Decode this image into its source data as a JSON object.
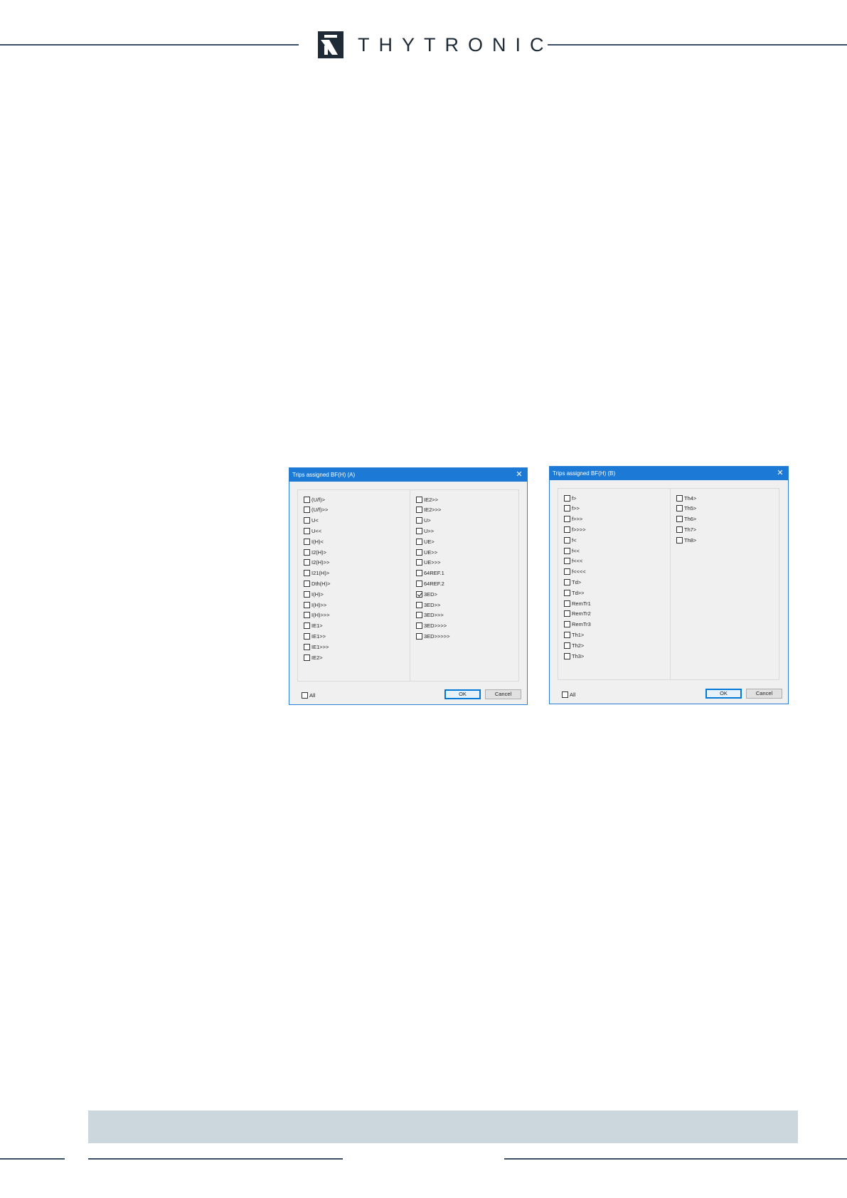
{
  "brand": {
    "name": "THYTRONIC",
    "color": "#1e2a35",
    "logo_icon": "thytronic-logo-icon"
  },
  "dialog_a": {
    "title": "Trips assigned BF(H) (A)",
    "col1": [
      {
        "label": "(U/f)>",
        "checked": false
      },
      {
        "label": "(U/f)>>",
        "checked": false
      },
      {
        "label": "U<",
        "checked": false
      },
      {
        "label": "U<<",
        "checked": false
      },
      {
        "label": "I(H)<",
        "checked": false
      },
      {
        "label": "I2(H)>",
        "checked": false
      },
      {
        "label": "I2(H)>>",
        "checked": false
      },
      {
        "label": "I21(H)>",
        "checked": false
      },
      {
        "label": "Dth(H)>",
        "checked": false
      },
      {
        "label": "I(H)>",
        "checked": false
      },
      {
        "label": "I(H)>>",
        "checked": false
      },
      {
        "label": "I(H)>>>",
        "checked": false
      },
      {
        "label": "IE1>",
        "checked": false
      },
      {
        "label": "IE1>>",
        "checked": false
      },
      {
        "label": "IE1>>>",
        "checked": false
      },
      {
        "label": "IE2>",
        "checked": false
      }
    ],
    "col2": [
      {
        "label": "IE2>>",
        "checked": false
      },
      {
        "label": "IE2>>>",
        "checked": false
      },
      {
        "label": "U>",
        "checked": false
      },
      {
        "label": "U>>",
        "checked": false
      },
      {
        "label": "UE>",
        "checked": false
      },
      {
        "label": "UE>>",
        "checked": false
      },
      {
        "label": "UE>>>",
        "checked": false
      },
      {
        "label": "64REF.1",
        "checked": false
      },
      {
        "label": "64REF.2",
        "checked": false
      },
      {
        "label": "3ED>",
        "checked": true
      },
      {
        "label": "3ED>>",
        "checked": false
      },
      {
        "label": "3ED>>>",
        "checked": false
      },
      {
        "label": "3ED>>>>",
        "checked": false
      },
      {
        "label": "3ED>>>>>",
        "checked": false
      }
    ],
    "all_label": "All",
    "ok_label": "OK",
    "cancel_label": "Cancel"
  },
  "dialog_b": {
    "title": "Trips assigned BF(H) (B)",
    "col1": [
      {
        "label": "f>",
        "checked": false
      },
      {
        "label": "f>>",
        "checked": false
      },
      {
        "label": "f>>>",
        "checked": false
      },
      {
        "label": "f>>>>",
        "checked": false
      },
      {
        "label": "f<",
        "checked": false
      },
      {
        "label": "f<<",
        "checked": false
      },
      {
        "label": "f<<<",
        "checked": false
      },
      {
        "label": "f<<<<",
        "checked": false
      },
      {
        "label": "Td>",
        "checked": false
      },
      {
        "label": "Td>>",
        "checked": false
      },
      {
        "label": "RemTr1",
        "checked": false
      },
      {
        "label": "RemTr2",
        "checked": false
      },
      {
        "label": "RemTr3",
        "checked": false
      },
      {
        "label": "Th1>",
        "checked": false
      },
      {
        "label": "Th2>",
        "checked": false
      },
      {
        "label": "Th3>",
        "checked": false
      }
    ],
    "col2": [
      {
        "label": "Th4>",
        "checked": false
      },
      {
        "label": "Th5>",
        "checked": false
      },
      {
        "label": "Th6>",
        "checked": false
      },
      {
        "label": "Th7>",
        "checked": false
      },
      {
        "label": "Th8>",
        "checked": false
      }
    ],
    "all_label": "All",
    "ok_label": "OK",
    "cancel_label": "Cancel"
  },
  "colors": {
    "titlebar": "#1c7ad6",
    "dialog_bg": "#f0f0f0",
    "footer_band": "#ccd7dd",
    "rule": "#3a4f66"
  }
}
